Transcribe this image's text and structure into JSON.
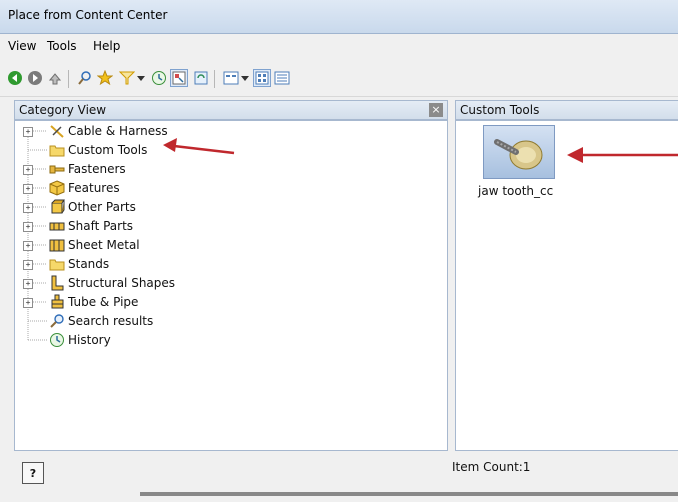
{
  "window": {
    "title": "Place from Content Center"
  },
  "menu": [
    "View",
    "Tools",
    "Help"
  ],
  "toolbar": {
    "icons": [
      "back-icon",
      "forward-icon",
      "up-icon",
      "search-icon",
      "favorites-icon",
      "filter-icon",
      "dropdown-icon",
      "history-icon",
      "tree-view-icon",
      "refresh-icon",
      "view-options-icon",
      "large-icons-view-icon",
      "details-view-icon"
    ]
  },
  "left_pane": {
    "title": "Category View",
    "close_label": "×",
    "items": [
      {
        "label": "Cable & Harness",
        "icon": "cable-icon",
        "expandable": true
      },
      {
        "label": "Custom Tools",
        "icon": "folder-icon",
        "expandable": false
      },
      {
        "label": "Fasteners",
        "icon": "fastener-icon",
        "expandable": true
      },
      {
        "label": "Features",
        "icon": "features-icon",
        "expandable": true
      },
      {
        "label": "Other Parts",
        "icon": "other-parts-icon",
        "expandable": true
      },
      {
        "label": "Shaft Parts",
        "icon": "shaft-icon",
        "expandable": true
      },
      {
        "label": "Sheet Metal",
        "icon": "sheet-metal-icon",
        "expandable": true
      },
      {
        "label": "Stands",
        "icon": "folder-icon",
        "expandable": true
      },
      {
        "label": "Structural Shapes",
        "icon": "structural-icon",
        "expandable": true
      },
      {
        "label": "Tube & Pipe",
        "icon": "tube-pipe-icon",
        "expandable": true
      },
      {
        "label": "Search results",
        "icon": "search-icon",
        "expandable": false
      },
      {
        "label": "History",
        "icon": "history-icon",
        "expandable": false
      }
    ]
  },
  "right_pane": {
    "title": "Custom Tools",
    "items": [
      {
        "label": "jaw tooth_cc",
        "icon": "part-thumbnail-icon"
      }
    ]
  },
  "status": {
    "help_label": "?",
    "item_count": "Item Count:1"
  },
  "colors": {
    "accent": "#3d7bd8",
    "arrow": "#c0282d",
    "folder": "#e9c34e"
  }
}
